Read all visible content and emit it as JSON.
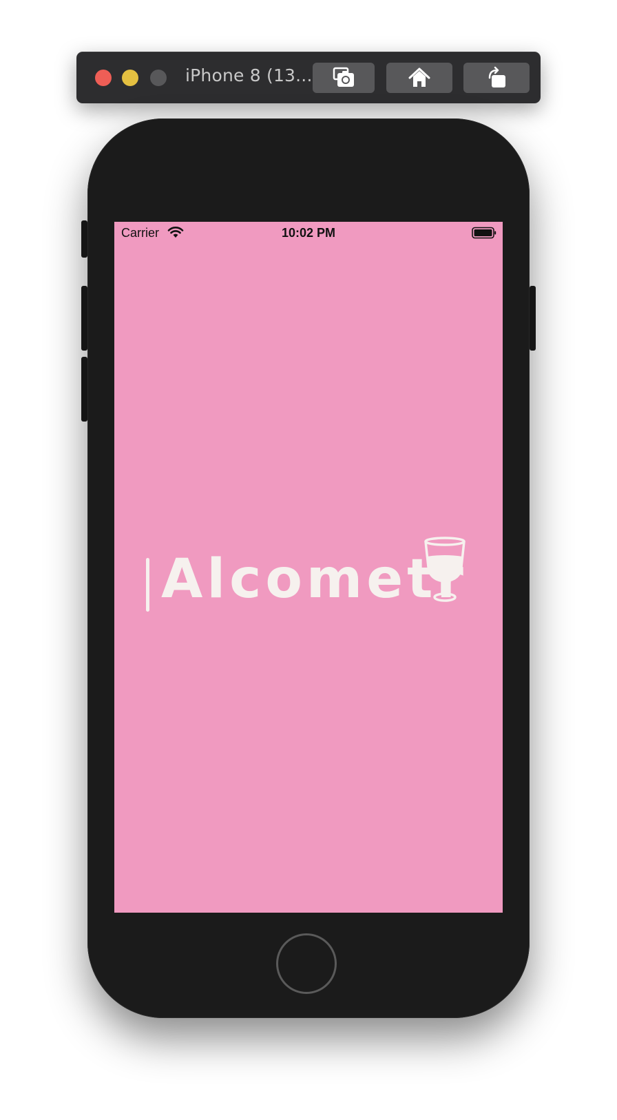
{
  "simulator": {
    "window_title": "iPhone 8 (13...",
    "buttons": {
      "screenshot_icon": "camera-icon",
      "home_icon": "house-icon",
      "rotate_icon": "rotate-icon"
    }
  },
  "status_bar": {
    "carrier": "Carrier",
    "time": "10:02 PM",
    "wifi_icon": "wifi-icon",
    "battery_icon": "battery-icon"
  },
  "splash": {
    "logo_text": "Alcometr",
    "logo_icon": "wine-glass-icon",
    "background_color": "#f09ac0",
    "foreground_color": "#f6f1ee"
  }
}
